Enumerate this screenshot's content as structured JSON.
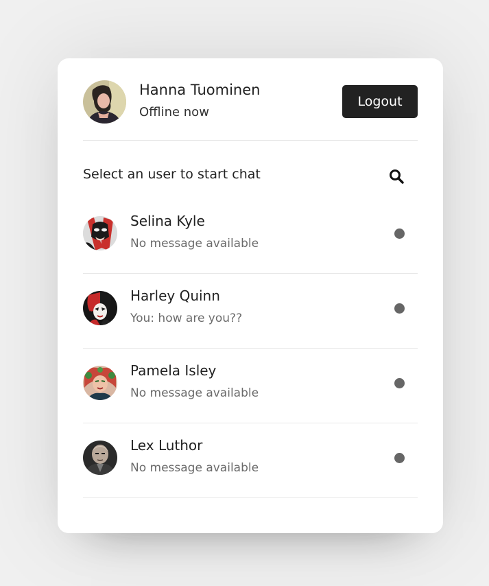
{
  "profile": {
    "name": "Hanna Tuominen",
    "status": "Offline now",
    "logout_label": "Logout"
  },
  "search": {
    "prompt": "Select an user to start chat",
    "icon": "search-icon"
  },
  "users": [
    {
      "name": "Selina Kyle",
      "message": "No message available",
      "status": "offline",
      "status_color": "#666666"
    },
    {
      "name": "Harley Quinn",
      "message": "You: how are you??",
      "status": "offline",
      "status_color": "#666666"
    },
    {
      "name": "Pamela Isley",
      "message": "No message available",
      "status": "offline",
      "status_color": "#666666"
    },
    {
      "name": "Lex Luthor",
      "message": "No message available",
      "status": "offline",
      "status_color": "#666666"
    }
  ],
  "colors": {
    "background": "#f0f0f0",
    "card": "#ffffff",
    "button": "#222222",
    "muted_text": "#6b6b6b"
  }
}
